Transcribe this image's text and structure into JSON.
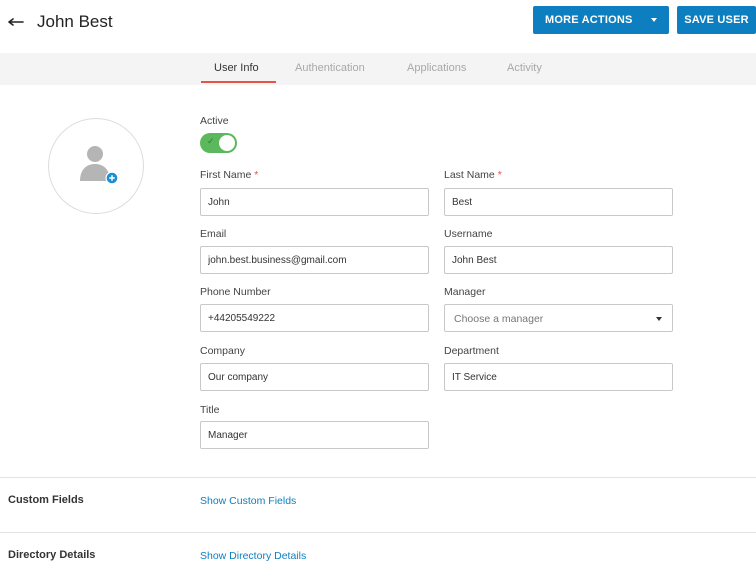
{
  "header": {
    "title": "John Best",
    "more_actions_label": "MORE ACTIONS",
    "save_label": "SAVE USER"
  },
  "tabs": [
    {
      "label": "User Info",
      "active": true
    },
    {
      "label": "Authentication",
      "active": false
    },
    {
      "label": "Applications",
      "active": false
    },
    {
      "label": "Activity",
      "active": false
    }
  ],
  "form": {
    "active": {
      "label": "Active",
      "value": true
    },
    "first_name": {
      "label": "First Name",
      "required": "*",
      "value": "John"
    },
    "last_name": {
      "label": "Last Name",
      "required": "*",
      "value": "Best"
    },
    "email": {
      "label": "Email",
      "value": "john.best.business@gmail.com"
    },
    "username": {
      "label": "Username",
      "value": "John Best"
    },
    "phone": {
      "label": "Phone Number",
      "value": "+44205549222"
    },
    "manager": {
      "label": "Manager",
      "placeholder": "Choose a manager"
    },
    "company": {
      "label": "Company",
      "value": "Our company"
    },
    "department": {
      "label": "Department",
      "value": "IT Service"
    },
    "title": {
      "label": "Title",
      "value": "Manager"
    }
  },
  "sections": {
    "custom_fields": {
      "label": "Custom Fields",
      "link": "Show Custom Fields"
    },
    "directory_details": {
      "label": "Directory Details",
      "link": "Show Directory Details"
    }
  },
  "colors": {
    "primary": "#0d7fc0",
    "tab_accent": "#e4544a",
    "toggle_on": "#5cb85c",
    "avatar_add": "#1a8fd6"
  },
  "icons": {
    "back": "left-arrow-icon",
    "avatar": "user-placeholder-icon",
    "add_photo": "plus-circle-icon",
    "dropdown": "caret-down-icon",
    "toggle_check": "check-icon"
  }
}
